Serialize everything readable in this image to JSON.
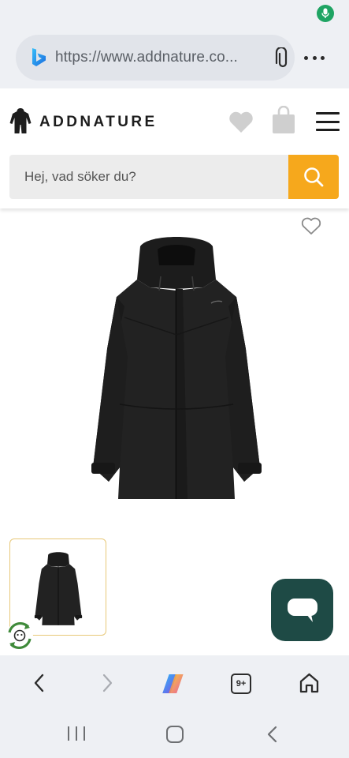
{
  "status_bar": {
    "mic_indicator": "mic-icon",
    "indicator_color": "#1fa463"
  },
  "browser": {
    "url": "https://www.addnature.co...",
    "search_engine_icon": "bing-icon",
    "attach_icon": "paperclip-icon",
    "menu_icon": "more-dots-icon"
  },
  "site_header": {
    "logo_text": "ADDNATURE",
    "wishlist_icon": "heart-icon",
    "cart_icon": "bag-icon",
    "menu_icon": "hamburger-icon",
    "search_placeholder": "Hej, vad söker du?",
    "search_button_color": "#f6a81c"
  },
  "product": {
    "image": "black-hooded-jacket",
    "wishlist_icon": "heart-outline-icon",
    "thumbnail_count": 1,
    "eco_badge": "recycle-badge-icon"
  },
  "chat": {
    "icon": "chat-bubble-icon",
    "color": "#1e4a45"
  },
  "bottom_nav": {
    "back": "back-arrow-icon",
    "forward": "forward-arrow-icon",
    "copilot": "copilot-icon",
    "tabs_count": "9+",
    "home": "home-icon"
  },
  "system_nav": {
    "recents": "recents-icon",
    "home": "home-circle-icon",
    "back": "back-chevron-icon"
  }
}
